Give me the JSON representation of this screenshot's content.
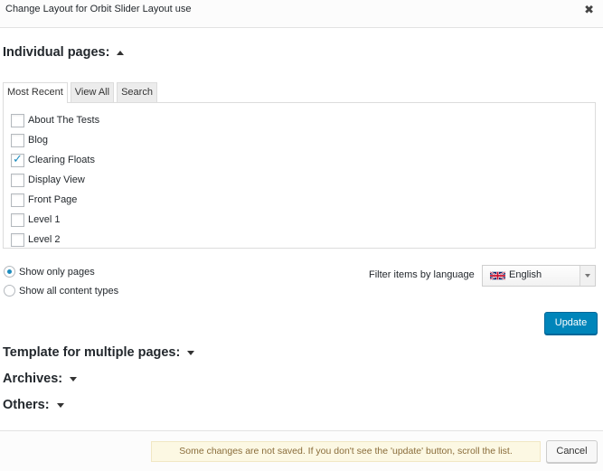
{
  "dialog": {
    "title": "Change Layout for Orbit Slider Layout use",
    "close_icon": "close-icon",
    "close_glyph": "✖"
  },
  "individual_pages": {
    "heading": "Individual pages:",
    "tabs": [
      {
        "label": "Most Recent",
        "active": true
      },
      {
        "label": "View All",
        "active": false
      },
      {
        "label": "Search",
        "active": false
      }
    ],
    "items": [
      {
        "label": "About The Tests",
        "checked": false
      },
      {
        "label": "Blog",
        "checked": false
      },
      {
        "label": "Clearing Floats",
        "checked": true
      },
      {
        "label": "Display View",
        "checked": false
      },
      {
        "label": "Front Page",
        "checked": false
      },
      {
        "label": "Level 1",
        "checked": false
      },
      {
        "label": "Level 2",
        "checked": false
      }
    ],
    "check_glyph": "✓",
    "radio_options": [
      {
        "label": "Show only pages",
        "selected": true
      },
      {
        "label": "Show all content types",
        "selected": false
      }
    ],
    "filter_label": "Filter items by language",
    "language": {
      "value": "English",
      "flag_icon": "uk-flag-icon"
    },
    "update_label": "Update"
  },
  "sections": [
    {
      "heading": "Template for multiple pages:"
    },
    {
      "heading": "Archives:"
    },
    {
      "heading": "Others:"
    }
  ],
  "footer": {
    "notice": "Some changes are not saved. If you don't see the 'update' button, scroll the list.",
    "cancel_label": "Cancel"
  },
  "colors": {
    "accent": "#0085ba",
    "check": "#1e8cbe",
    "notice_bg": "#fcf8e3",
    "notice_text": "#8a6d3b"
  }
}
